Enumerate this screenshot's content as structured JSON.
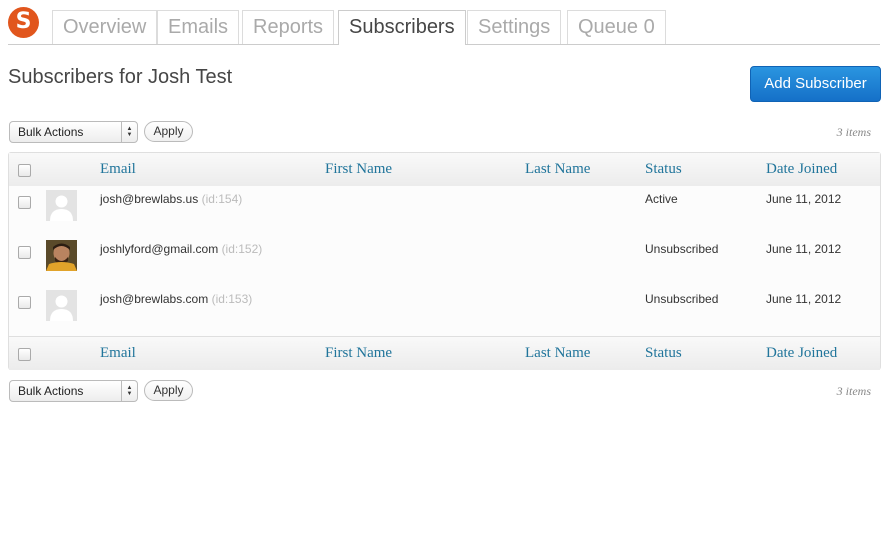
{
  "logo": {
    "letter": "S"
  },
  "tabs": [
    {
      "label": "Overview"
    },
    {
      "label": "Emails"
    },
    {
      "label": "Reports"
    },
    {
      "label": "Subscribers"
    },
    {
      "label": "Settings"
    },
    {
      "label": "Queue 0"
    }
  ],
  "page": {
    "title": "Subscribers for Josh Test",
    "add_button": "Add Subscriber"
  },
  "toolbar": {
    "bulk_actions": "Bulk Actions",
    "apply": "Apply",
    "count": "3 items"
  },
  "columns": {
    "email": "Email",
    "first_name": "First Name",
    "last_name": "Last Name",
    "status": "Status",
    "date_joined": "Date Joined"
  },
  "rows": [
    {
      "email": "josh@brewlabs.us",
      "id": "(id:154)",
      "first_name": "",
      "last_name": "",
      "status": "Active",
      "date_joined": "June 11, 2012",
      "avatar": "default"
    },
    {
      "email": "joshlyford@gmail.com",
      "id": "(id:152)",
      "first_name": "",
      "last_name": "",
      "status": "Unsubscribed",
      "date_joined": "June 11, 2012",
      "avatar": "photo"
    },
    {
      "email": "josh@brewlabs.com",
      "id": "(id:153)",
      "first_name": "",
      "last_name": "",
      "status": "Unsubscribed",
      "date_joined": "June 11, 2012",
      "avatar": "default"
    }
  ],
  "colors": {
    "accent": "#e1561d",
    "link": "#21759b",
    "primary_button": "#1a7fd6"
  }
}
